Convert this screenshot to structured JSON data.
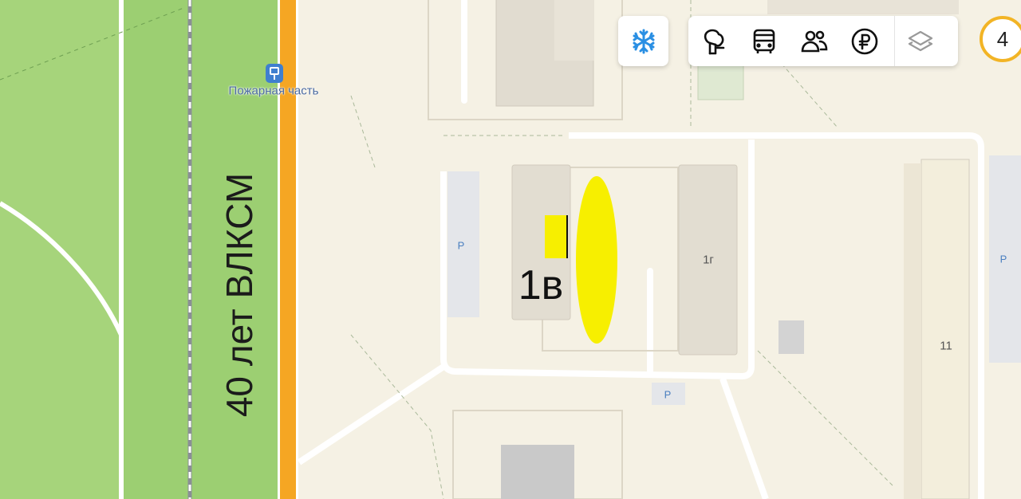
{
  "street": {
    "name": "40 лет ВЛКСМ"
  },
  "poi": {
    "name": "Пожарная часть",
    "icon": "bus-stop-icon"
  },
  "houses": {
    "highlighted": "1в",
    "right": "1г",
    "far_right": "11"
  },
  "parking_label": "P",
  "controls": {
    "winter_icon": "snowflake-icon",
    "toolbar_icons": [
      "sights-icon",
      "transport-icon",
      "people-icon",
      "ruble-icon",
      "layers-icon"
    ],
    "badge_value": "4"
  },
  "colors": {
    "park": "#9ccf72",
    "highway": "#f5a623",
    "highlight": "#f7ef00",
    "snow": "#2a8fe3",
    "badge_ring": "#f2b425"
  }
}
